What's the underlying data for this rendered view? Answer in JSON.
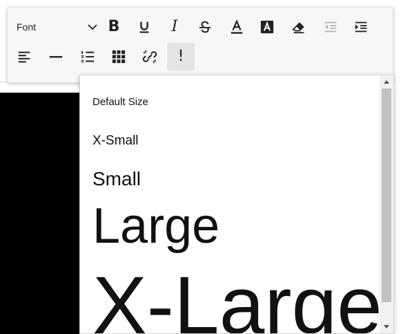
{
  "toolbar": {
    "font_select": {
      "label": "Font"
    },
    "bold_glyph": "B",
    "underline_glyph": "U",
    "italic_glyph": "I",
    "special_char_glyph": "!"
  },
  "font_size_dropdown": {
    "options": [
      "Default Size",
      "X-Small",
      "Small",
      "Large",
      "X-Large"
    ]
  }
}
